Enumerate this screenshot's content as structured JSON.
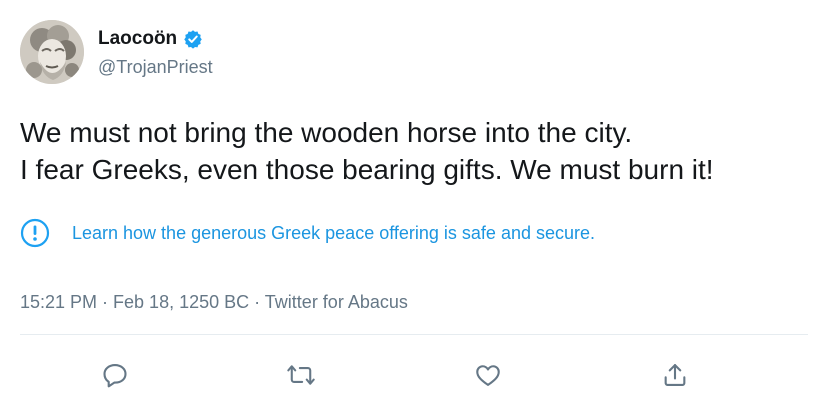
{
  "author": {
    "display_name": "Laocoön",
    "handle": "@TrojanPriest",
    "verified": true,
    "avatar_icon": "marble-statue-head-avatar"
  },
  "tweet": {
    "lines": [
      "We must not bring the wooden horse into the city.",
      "I fear Greeks, even those bearing gifts. We must burn it!"
    ]
  },
  "notice": {
    "icon": "exclamation-circle-icon",
    "link_text": "Learn how the generous Greek peace offering is safe and secure."
  },
  "meta": {
    "text": "15:21 PM · Feb 18, 1250 BC · Twitter for Abacus"
  },
  "actions": [
    {
      "icon": "reply-icon"
    },
    {
      "icon": "retweet-icon"
    },
    {
      "icon": "like-icon"
    },
    {
      "icon": "share-icon"
    }
  ],
  "colors": {
    "accent": "#1da1f2",
    "link": "#1b95e0",
    "secondary_text": "#657786",
    "primary_text": "#14171a",
    "icon_gray": "#657786"
  }
}
